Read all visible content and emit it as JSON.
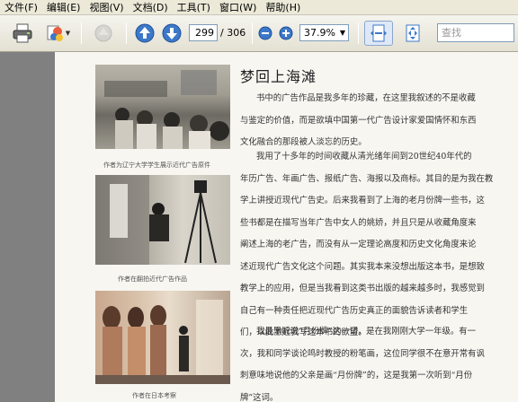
{
  "menu": [
    "文件(F)",
    "编辑(E)",
    "视图(V)",
    "文档(D)",
    "工具(T)",
    "窗口(W)",
    "帮助(H)"
  ],
  "toolbar": {
    "current_page": "299",
    "total_pages": "/ 306",
    "zoom": "37.9%",
    "search_placeholder": "查找"
  },
  "document": {
    "title": "梦回上海滩",
    "captions": [
      "作者为辽宁大学学生展示近代广告原件",
      "作者在翻拍近代广告作品",
      "作者在日本考察"
    ],
    "para1": [
      "书中的广告作品是我多年的珍藏，在这里我叙述的不是收藏",
      "与鉴定的价值，而是欲填中国第一代广告设计家爱国情怀和东西",
      "文化融合的那段被人淡忘的历史。"
    ],
    "para2": [
      "我用了十多年的时间收藏从清光绪年间到20世纪40年代的",
      "年历广告、年画广告、报纸广告、海报以及商标。其目的是为我在教",
      "学上讲授近现代广告史。后来我看到了上海的老月份牌一些书，这",
      "些书都是在描写当年广告中女人的姚娇，并且只是从收藏角度来",
      "阐述上海的老广告，而没有从一定理论高度和历史文化角度来论",
      "述近现代广告文化这个问题。其实我本来没想出版这本书，是想致",
      "教学上的应用，但是当我看到这类书出版的越来越多时，我感觉到",
      "自己有一种责任把近现代广告历史真正的面貌告诉读者和学生",
      "们，以此激起我写这本书的欲望。"
    ],
    "para3": [
      "我最早听说“月份牌”这一词，是在我刚刚大学一年级。有一",
      "次，我和同学谈论鸣时教授的粉笔画，这位同学很不在意开常有讽",
      "刺意味地说他的父亲是画“月份牌”的，这是我第一次听到“月份",
      "牌”这词。"
    ]
  },
  "colors": {
    "chrome": "#ece9d8",
    "page": "#f7f6f1",
    "workspace": "#808080",
    "accent_blue": "#3d78c8"
  }
}
